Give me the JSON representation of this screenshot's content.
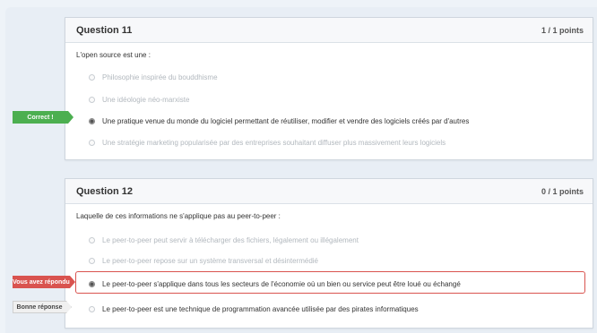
{
  "q11": {
    "title": "Question 11",
    "points": "1 / 1 points",
    "prompt": "L'open source est une :",
    "options": [
      "Philosophie inspirée du bouddhisme",
      "Une idéologie néo-marxiste",
      "Une pratique venue du monde du logiciel permettant de réutiliser, modifier et vendre des logiciels créés par d'autres",
      "Une stratégie marketing popularisée par des entreprises souhaitant diffuser plus massivement leurs logiciels"
    ],
    "tag_correct": "Correct !"
  },
  "q12": {
    "title": "Question 12",
    "points": "0 / 1 points",
    "prompt": "Laquelle de ces informations ne s'applique pas au peer-to-peer :",
    "options": [
      "Le peer-to-peer peut servir à télécharger des fichiers, légalement ou illégalement",
      "Le peer-to-peer repose sur un système transversal et désintermédié",
      "Le peer-to-peer s'applique dans tous les secteurs de l'économie où un bien ou service peut être loué ou échangé",
      "Le peer-to-peer est une technique de programmation avancée utilisée par des pirates informatiques"
    ],
    "tag_answered": "Vous avez répondu",
    "tag_correct_answer": "Bonne réponse"
  },
  "colors": {
    "correct": "#4caf50",
    "wrong": "#d9534f"
  }
}
